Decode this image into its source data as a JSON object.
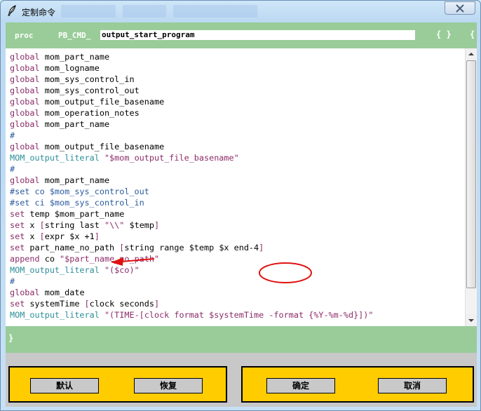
{
  "window": {
    "title": "定制命令"
  },
  "proc_bar": {
    "keyword": "proc",
    "prefix": "PB_CMD_",
    "name_value": "output_start_program",
    "open_brace": "{ }",
    "brace_right": "{"
  },
  "code_lines": [
    {
      "parts": [
        {
          "t": "global",
          "c": "kw"
        },
        {
          "t": " mom_part_name",
          "c": ""
        }
      ]
    },
    {
      "parts": [
        {
          "t": "global",
          "c": "kw"
        },
        {
          "t": " mom_logname",
          "c": ""
        }
      ]
    },
    {
      "parts": [
        {
          "t": "global",
          "c": "kw"
        },
        {
          "t": " mom_sys_control_in",
          "c": ""
        }
      ]
    },
    {
      "parts": [
        {
          "t": "global",
          "c": "kw"
        },
        {
          "t": " mom_sys_control_out",
          "c": ""
        }
      ]
    },
    {
      "parts": [
        {
          "t": "global",
          "c": "kw"
        },
        {
          "t": " mom_output_file_basename",
          "c": ""
        }
      ]
    },
    {
      "parts": [
        {
          "t": "global",
          "c": "kw"
        },
        {
          "t": " mom_operation_notes",
          "c": ""
        }
      ]
    },
    {
      "parts": [
        {
          "t": "global",
          "c": "kw"
        },
        {
          "t": " mom_part_name",
          "c": ""
        }
      ]
    },
    {
      "parts": [
        {
          "t": "#",
          "c": "cm"
        }
      ]
    },
    {
      "parts": [
        {
          "t": "global",
          "c": "kw"
        },
        {
          "t": " mom_output_file_basename",
          "c": ""
        }
      ]
    },
    {
      "parts": [
        {
          "t": "MOM_output_literal",
          "c": "mom"
        },
        {
          "t": " ",
          "c": ""
        },
        {
          "t": "\"$mom_output_file_basename\"",
          "c": "str"
        }
      ]
    },
    {
      "parts": [
        {
          "t": "#",
          "c": "cm"
        }
      ]
    },
    {
      "parts": [
        {
          "t": "global",
          "c": "kw"
        },
        {
          "t": " mom_part_name",
          "c": ""
        }
      ]
    },
    {
      "parts": [
        {
          "t": "#set co $mom_sys_control_out",
          "c": "cm"
        }
      ]
    },
    {
      "parts": [
        {
          "t": "#set ci $mom_sys_control_in",
          "c": "cm"
        }
      ]
    },
    {
      "parts": [
        {
          "t": "set",
          "c": "kw"
        },
        {
          "t": " temp $mom_part_name",
          "c": ""
        }
      ]
    },
    {
      "parts": [
        {
          "t": "set",
          "c": "kw"
        },
        {
          "t": " x ",
          "c": ""
        },
        {
          "t": "[",
          "c": "br"
        },
        {
          "t": "string last ",
          "c": ""
        },
        {
          "t": "\"\\\\\"",
          "c": "str"
        },
        {
          "t": " $temp",
          "c": ""
        },
        {
          "t": "]",
          "c": "br"
        }
      ]
    },
    {
      "parts": [
        {
          "t": "set",
          "c": "kw"
        },
        {
          "t": " x ",
          "c": ""
        },
        {
          "t": "[",
          "c": "br"
        },
        {
          "t": "expr $x +1",
          "c": ""
        },
        {
          "t": "]",
          "c": "br"
        }
      ]
    },
    {
      "parts": [
        {
          "t": "set",
          "c": "kw"
        },
        {
          "t": " part_name_no_path ",
          "c": ""
        },
        {
          "t": "[",
          "c": "br"
        },
        {
          "t": "string range $temp $x end-4",
          "c": ""
        },
        {
          "t": "]",
          "c": "br"
        }
      ]
    },
    {
      "parts": [
        {
          "t": "append",
          "c": "kw"
        },
        {
          "t": " co ",
          "c": ""
        },
        {
          "t": "\"$part_name_no_path\"",
          "c": "str"
        }
      ]
    },
    {
      "parts": [
        {
          "t": "MOM_output_literal",
          "c": "mom"
        },
        {
          "t": " ",
          "c": ""
        },
        {
          "t": "\"($co)\"",
          "c": "str"
        }
      ]
    },
    {
      "parts": [
        {
          "t": "#",
          "c": "cm"
        }
      ]
    },
    {
      "parts": [
        {
          "t": "global",
          "c": "kw"
        },
        {
          "t": " mom_date",
          "c": ""
        }
      ]
    },
    {
      "parts": [
        {
          "t": "set",
          "c": "kw"
        },
        {
          "t": " systemTime ",
          "c": ""
        },
        {
          "t": "[",
          "c": "br"
        },
        {
          "t": "clock seconds",
          "c": ""
        },
        {
          "t": "]",
          "c": "br"
        }
      ]
    },
    {
      "parts": [
        {
          "t": "MOM_output_literal",
          "c": "mom"
        },
        {
          "t": " ",
          "c": ""
        },
        {
          "t": "\"(TIME-[clock format $systemTime -format {%Y-%m-%d}])\"",
          "c": "str"
        }
      ]
    }
  ],
  "close_bar": {
    "close_brace": "}"
  },
  "buttons": {
    "default": "默认",
    "restore": "恢复",
    "ok": "确定",
    "cancel": "取消"
  },
  "colors": {
    "keyword": "#8b2c69",
    "mom_command": "#2a8f99",
    "comment": "#2a5b9f",
    "bar_green": "#99cc99",
    "button_group": "#ffcc00",
    "annotation_red": "#e01010"
  }
}
